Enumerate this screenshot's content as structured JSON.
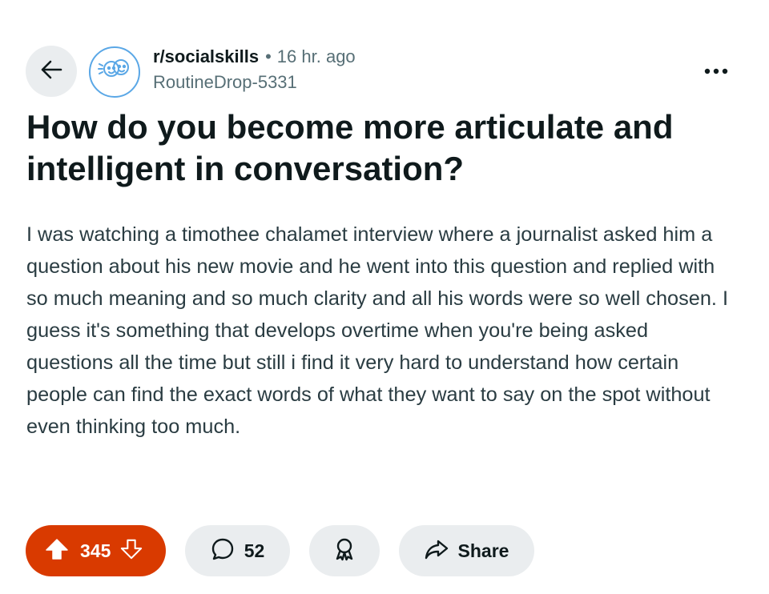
{
  "header": {
    "subreddit": "r/socialskills",
    "separator": "•",
    "age": "16 hr. ago",
    "author": "RoutineDrop-5331",
    "back_icon": "arrow-left-icon",
    "avatar_icon": "socialskills-community-icon",
    "more_icon": "ellipsis-icon",
    "avatar_border_color": "#5aa7e6"
  },
  "post": {
    "title": "How do you become more articulate and intelligent in conversation?",
    "body": "I was watching a timothee chalamet interview where a journalist asked him a question about his new movie and he went into this question and replied with so much meaning and so much clarity and all his words were so well chosen. I guess it's something that develops overtime when you're being asked questions all the time but still i find it very hard to understand how certain people can find the exact words of what they want to say on the spot without even thinking too much."
  },
  "actions": {
    "votes": "345",
    "vote_color": "#d93a00",
    "upvote_icon": "upvote-arrow-icon",
    "downvote_icon": "downvote-arrow-icon",
    "comments": "52",
    "comment_icon": "comment-bubble-icon",
    "award_icon": "award-ribbon-icon",
    "share_label": "Share",
    "share_icon": "share-arrow-icon"
  }
}
